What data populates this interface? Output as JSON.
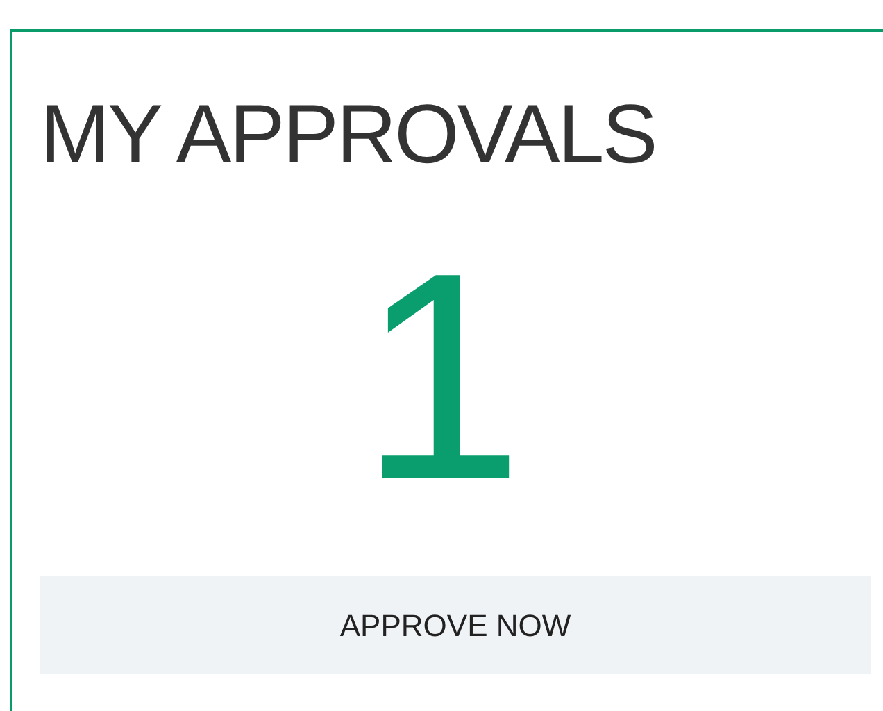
{
  "card": {
    "title": "MY APPROVALS",
    "count": "1",
    "button": "APPROVE NOW"
  }
}
